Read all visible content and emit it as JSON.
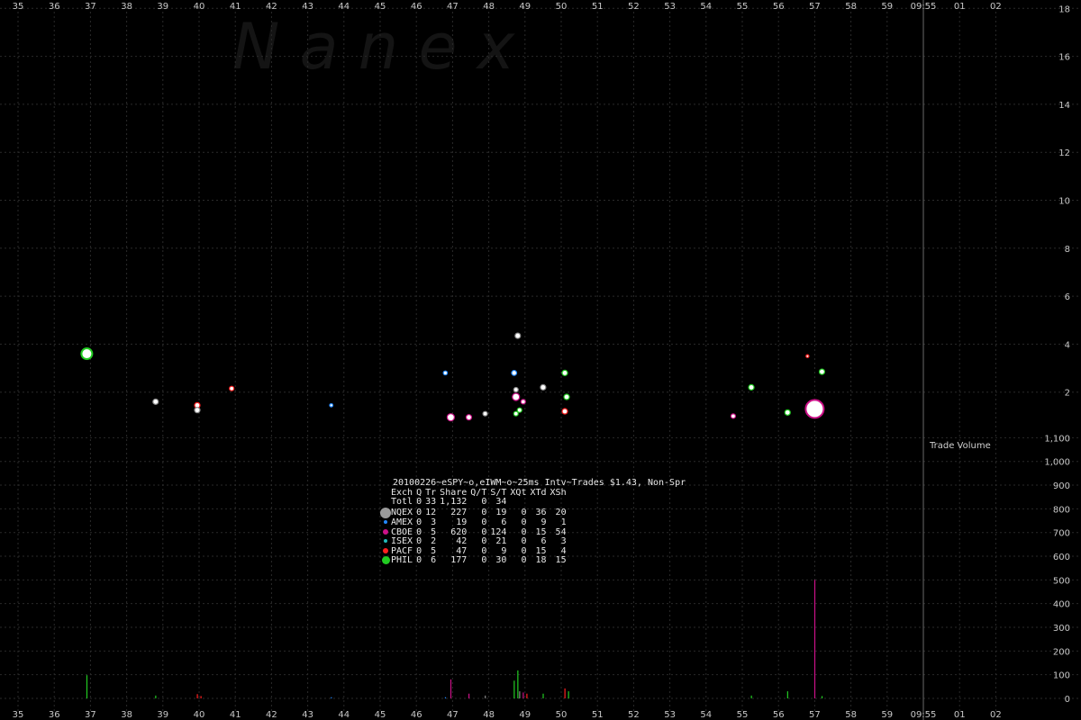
{
  "watermark": "N   a   n   e   x",
  "chart_data": {
    "type": "scatter",
    "x_tick_labels": [
      "35",
      "36",
      "37",
      "38",
      "39",
      "40",
      "41",
      "42",
      "43",
      "44",
      "45",
      "46",
      "47",
      "48",
      "49",
      "50",
      "51",
      "52",
      "53",
      "54",
      "55",
      "56",
      "57",
      "58",
      "59",
      "09:55",
      "01",
      "02"
    ],
    "price_axis": {
      "ticks": [
        2,
        4,
        6,
        8,
        10,
        12,
        14,
        16,
        18
      ],
      "range": [
        0,
        18
      ]
    },
    "volume_axis": {
      "label": "Trade Volume",
      "ticks": [
        0,
        100,
        200,
        300,
        400,
        500,
        600,
        700,
        800,
        900,
        1000,
        1100
      ],
      "tick_labels": [
        "0",
        "100",
        "200",
        "300",
        "400",
        "500",
        "600",
        "700",
        "800",
        "900",
        "1,000",
        "1,100"
      ],
      "range": [
        0,
        1100
      ]
    },
    "marker_line_at": "09:55",
    "points": [
      {
        "x": 36.9,
        "y": 3.6,
        "size": 6,
        "color": "#22cc22"
      },
      {
        "x": 38.8,
        "y": 1.6,
        "size": 3,
        "color": "#888888"
      },
      {
        "x": 39.95,
        "y": 1.45,
        "size": 3,
        "color": "#ff2020"
      },
      {
        "x": 39.95,
        "y": 1.25,
        "size": 3,
        "color": "#888888"
      },
      {
        "x": 40.9,
        "y": 2.15,
        "size": 2.5,
        "color": "#ff2020"
      },
      {
        "x": 43.65,
        "y": 1.45,
        "size": 1.8,
        "color": "#2288ff"
      },
      {
        "x": 46.8,
        "y": 2.8,
        "size": 2.2,
        "color": "#2288ff"
      },
      {
        "x": 46.95,
        "y": 0.95,
        "size": 4,
        "color": "#cc1188"
      },
      {
        "x": 47.45,
        "y": 0.95,
        "size": 3,
        "color": "#cc1188"
      },
      {
        "x": 47.9,
        "y": 1.1,
        "size": 2.5,
        "color": "#888888"
      },
      {
        "x": 48.75,
        "y": 1.1,
        "size": 2.5,
        "color": "#22cc22"
      },
      {
        "x": 48.85,
        "y": 1.25,
        "size": 2.5,
        "color": "#22cc22"
      },
      {
        "x": 48.75,
        "y": 1.8,
        "size": 4,
        "color": "#cc1188"
      },
      {
        "x": 48.75,
        "y": 2.1,
        "size": 2.5,
        "color": "#888888"
      },
      {
        "x": 48.95,
        "y": 1.6,
        "size": 2.5,
        "color": "#cc1188"
      },
      {
        "x": 48.7,
        "y": 2.8,
        "size": 2.8,
        "color": "#2288ff"
      },
      {
        "x": 48.8,
        "y": 4.35,
        "size": 3,
        "color": "#888888"
      },
      {
        "x": 49.5,
        "y": 2.2,
        "size": 3,
        "color": "#888888"
      },
      {
        "x": 50.1,
        "y": 2.8,
        "size": 3,
        "color": "#22cc22"
      },
      {
        "x": 50.15,
        "y": 1.8,
        "size": 3,
        "color": "#22cc22"
      },
      {
        "x": 50.1,
        "y": 1.2,
        "size": 3,
        "color": "#ff2020"
      },
      {
        "x": 54.75,
        "y": 1.0,
        "size": 2.5,
        "color": "#cc1188"
      },
      {
        "x": 55.25,
        "y": 2.2,
        "size": 3,
        "color": "#22cc22"
      },
      {
        "x": 56.25,
        "y": 1.15,
        "size": 3,
        "color": "#22cc22"
      },
      {
        "x": 56.8,
        "y": 3.5,
        "size": 1.6,
        "color": "#ff2020"
      },
      {
        "x": 57.0,
        "y": 1.3,
        "size": 10,
        "color": "#cc1188"
      },
      {
        "x": 57.2,
        "y": 2.85,
        "size": 3,
        "color": "#22cc22"
      }
    ],
    "volume_bars": [
      {
        "x": 36.9,
        "v": 98,
        "color": "#22cc22"
      },
      {
        "x": 38.8,
        "v": 12,
        "color": "#22cc22"
      },
      {
        "x": 39.95,
        "v": 18,
        "color": "#ff2020"
      },
      {
        "x": 40.05,
        "v": 10,
        "color": "#ff2020"
      },
      {
        "x": 43.65,
        "v": 5,
        "color": "#2288ff"
      },
      {
        "x": 46.8,
        "v": 5,
        "color": "#2288ff"
      },
      {
        "x": 46.95,
        "v": 80,
        "color": "#cc1188"
      },
      {
        "x": 47.45,
        "v": 20,
        "color": "#cc1188"
      },
      {
        "x": 47.9,
        "v": 12,
        "color": "#888888"
      },
      {
        "x": 48.7,
        "v": 75,
        "color": "#22cc22"
      },
      {
        "x": 48.8,
        "v": 118,
        "color": "#22cc22"
      },
      {
        "x": 48.85,
        "v": 30,
        "color": "#888888"
      },
      {
        "x": 48.95,
        "v": 25,
        "color": "#cc1188"
      },
      {
        "x": 49.05,
        "v": 20,
        "color": "#ff2020"
      },
      {
        "x": 49.5,
        "v": 20,
        "color": "#22cc22"
      },
      {
        "x": 50.1,
        "v": 42,
        "color": "#ff2020"
      },
      {
        "x": 50.2,
        "v": 30,
        "color": "#22cc22"
      },
      {
        "x": 55.25,
        "v": 12,
        "color": "#22cc22"
      },
      {
        "x": 56.25,
        "v": 30,
        "color": "#22cc22"
      },
      {
        "x": 57.0,
        "v": 500,
        "color": "#cc1188"
      },
      {
        "x": 57.2,
        "v": 10,
        "color": "#22cc22"
      }
    ]
  },
  "legend": {
    "title": "20100226~eSPY~o,eIWM~o~25ms Intv~Trades $1.43, Non-Spr",
    "headers": [
      "Exch",
      "Q",
      "Tr",
      "Share",
      "Q/T",
      "S/T",
      "XQt",
      "XTd",
      "XSh"
    ],
    "rows": [
      {
        "name": "Totl",
        "q": "0",
        "tr": "33",
        "share": "1,132",
        "qt": "0",
        "st": "34",
        "xqt": "",
        "xtd": "",
        "xsh": "",
        "color": "",
        "dot": 0
      },
      {
        "name": "NQEX",
        "q": "0",
        "tr": "12",
        "share": "227",
        "qt": "0",
        "st": "19",
        "xqt": "0",
        "xtd": "36",
        "xsh": "20",
        "color": "#9a9a9a",
        "dot": 12
      },
      {
        "name": "AMEX",
        "q": "0",
        "tr": "3",
        "share": "19",
        "qt": "0",
        "st": "6",
        "xqt": "0",
        "xtd": "9",
        "xsh": "1",
        "color": "#2288ff",
        "dot": 4
      },
      {
        "name": "CBOE",
        "q": "0",
        "tr": "5",
        "share": "620",
        "qt": "0",
        "st": "124",
        "xqt": "0",
        "xtd": "15",
        "xsh": "54",
        "color": "#cc1188",
        "dot": 6
      },
      {
        "name": "ISEX",
        "q": "0",
        "tr": "2",
        "share": "42",
        "qt": "0",
        "st": "21",
        "xqt": "0",
        "xtd": "6",
        "xsh": "3",
        "color": "#22bbbb",
        "dot": 4
      },
      {
        "name": "PACF",
        "q": "0",
        "tr": "5",
        "share": "47",
        "qt": "0",
        "st": "9",
        "xqt": "0",
        "xtd": "15",
        "xsh": "4",
        "color": "#ff2020",
        "dot": 6
      },
      {
        "name": "PHIL",
        "q": "0",
        "tr": "6",
        "share": "177",
        "qt": "0",
        "st": "30",
        "xqt": "0",
        "xtd": "18",
        "xsh": "15",
        "color": "#22cc22",
        "dot": 9
      }
    ]
  }
}
